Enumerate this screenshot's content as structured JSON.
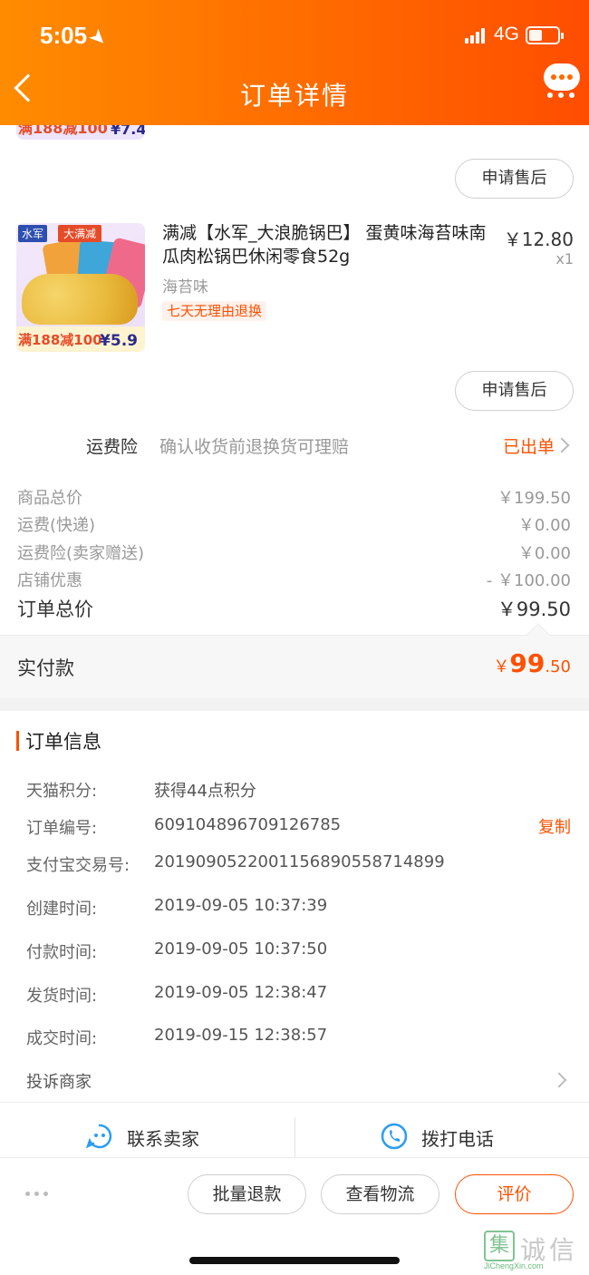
{
  "status_bar": {
    "time": "5:05",
    "network": "4G"
  },
  "header": {
    "title": "订单详情"
  },
  "top_item": {
    "promo": "满188减100",
    "promo_price": "¥7.4",
    "after_sale_label": "申请售后"
  },
  "product": {
    "name": "满减【水军_大浪脆锅巴】 蛋黄味海苔味南瓜肉松锅巴休闲零食52g",
    "price": "￥12.80",
    "quantity": "x1",
    "spec": "海苔味",
    "tag": "七天无理由退换",
    "image_brand": "水军",
    "image_brand_tag": "大满减",
    "image_promo": "满188减100",
    "image_price": "¥5.9",
    "after_sale_label": "申请售后"
  },
  "shipping_insurance": {
    "label": "运费险",
    "description": "确认收货前退换货可理赔",
    "status": "已出单"
  },
  "price_summary": {
    "items": [
      {
        "label": "商品总价",
        "value": "￥199.50"
      },
      {
        "label": "运费(快递)",
        "value": "￥0.00"
      },
      {
        "label": "运费险(卖家赠送)",
        "value": "￥0.00"
      },
      {
        "label": "店铺优惠",
        "value": "- ￥100.00"
      }
    ],
    "total_label": "订单总价",
    "total_value": "￥99.50",
    "paid_label": "实付款",
    "paid_currency": "￥",
    "paid_integer": "99",
    "paid_decimal": ".50"
  },
  "order_info": {
    "title": "订单信息",
    "rows": [
      {
        "label": "天猫积分:",
        "value": "获得44点积分"
      },
      {
        "label": "订单编号:",
        "value": "609104896709126785"
      },
      {
        "label": "支付宝交易号:",
        "value": "2019090522001156890558714899"
      },
      {
        "label": "创建时间:",
        "value": "2019-09-05 10:37:39"
      },
      {
        "label": "付款时间:",
        "value": "2019-09-05 10:37:50"
      },
      {
        "label": "发货时间:",
        "value": "2019-09-05 12:38:47"
      },
      {
        "label": "成交时间:",
        "value": "2019-09-15 12:38:57"
      }
    ],
    "copy_label": "复制",
    "complaint_label": "投诉商家"
  },
  "contact": {
    "chat_label": "联系卖家",
    "call_label": "拨打电话"
  },
  "actions": {
    "batch_refund": "批量退款",
    "logistics": "查看物流",
    "review": "评价"
  },
  "watermark": {
    "text": "诚信",
    "glyph": "集",
    "url": "JiChengXin.com"
  },
  "colors": {
    "accent": "#ff5000",
    "header_start": "#ff8c00",
    "header_end": "#ff4d00",
    "chat_icon": "#2a9df4"
  }
}
